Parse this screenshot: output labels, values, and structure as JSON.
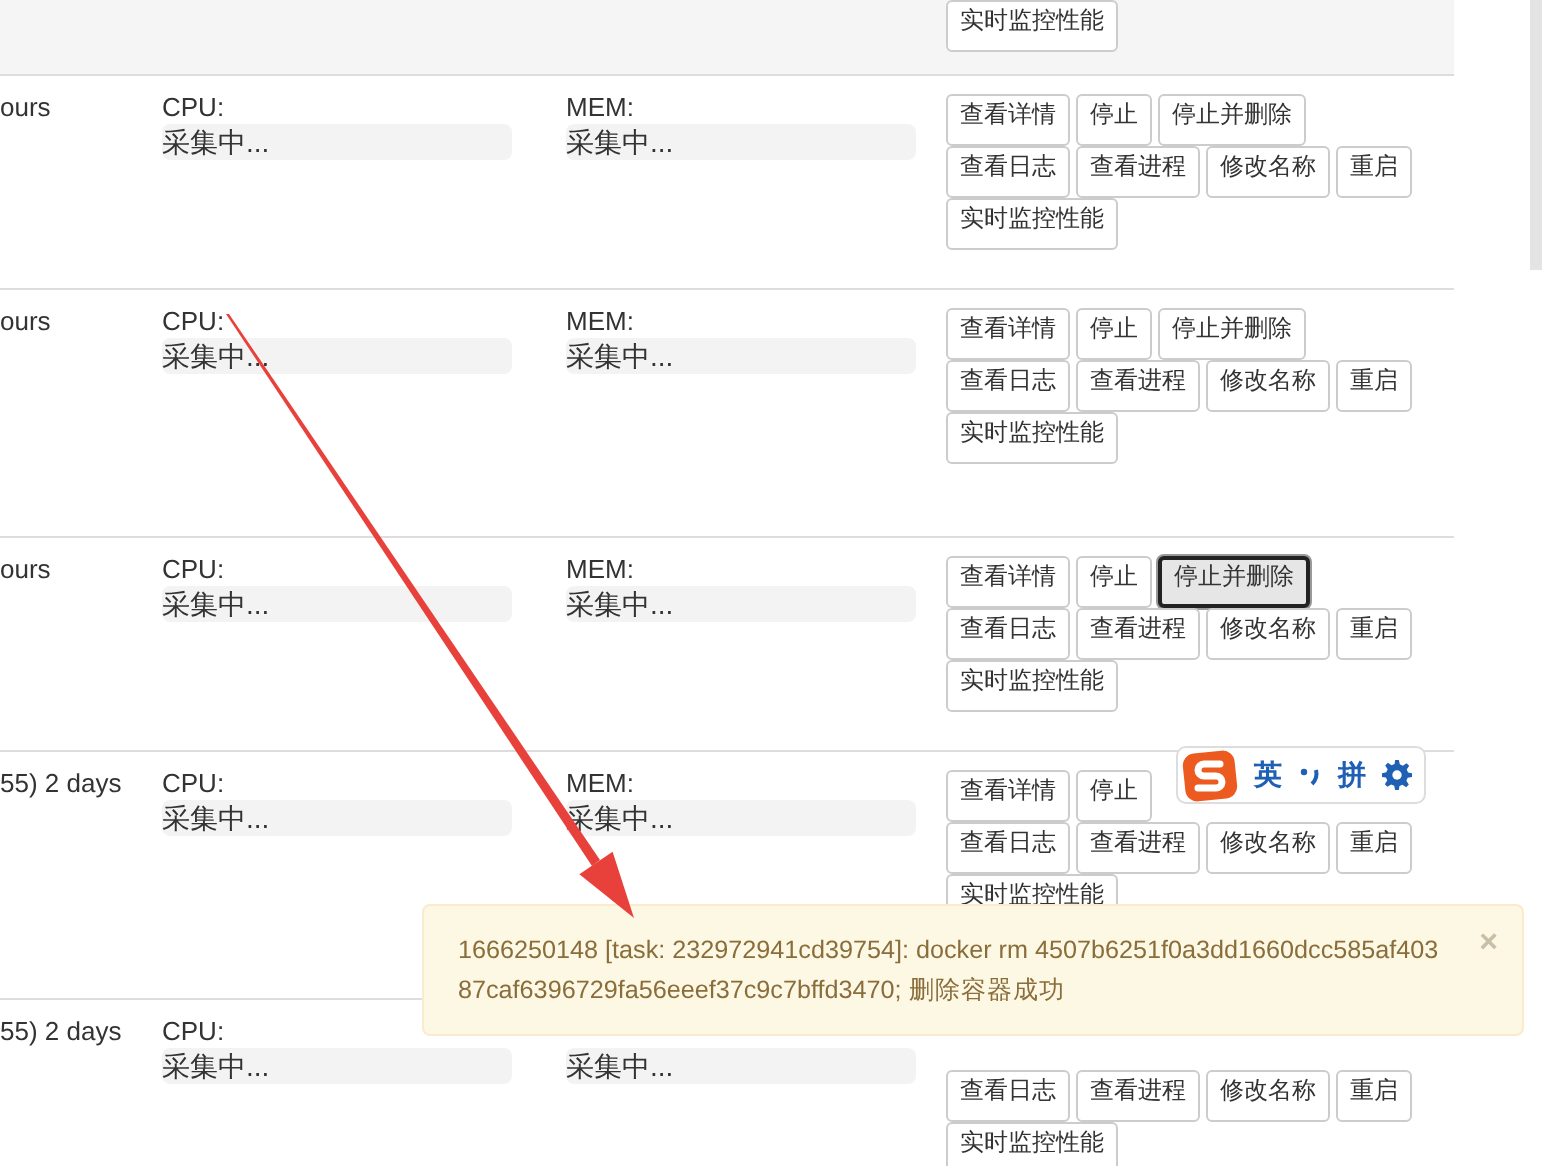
{
  "rows": [
    {
      "hovered": true,
      "buttons": [
        [
          {
            "label": "实时监控性能",
            "focused": false
          }
        ]
      ]
    },
    {
      "hovered": false,
      "uptime": "ours",
      "cpu": {
        "label": "CPU:",
        "reading": "采集中...",
        "level": 0
      },
      "mem": {
        "label": "MEM:",
        "reading": "采集中...",
        "level": 0
      },
      "buttons": [
        [
          {
            "label": "查看详情",
            "focused": false
          },
          {
            "label": "停止",
            "focused": false
          },
          {
            "label": "停止并删除",
            "focused": false
          }
        ],
        [
          {
            "label": "查看日志",
            "focused": false
          },
          {
            "label": "查看进程",
            "focused": false
          },
          {
            "label": "修改名称",
            "focused": false
          },
          {
            "label": "重启",
            "focused": false
          }
        ],
        [
          {
            "label": "实时监控性能",
            "focused": false
          }
        ]
      ]
    },
    {
      "hovered": false,
      "uptime": "ours",
      "cpu": {
        "label": "CPU:",
        "reading": "采集中...",
        "level": 0
      },
      "mem": {
        "label": "MEM:",
        "reading": "采集中...",
        "level": 0
      },
      "buttons": [
        [
          {
            "label": "查看详情",
            "focused": false
          },
          {
            "label": "停止",
            "focused": false
          },
          {
            "label": "停止并删除",
            "focused": false
          }
        ],
        [
          {
            "label": "查看日志",
            "focused": false
          },
          {
            "label": "查看进程",
            "focused": false
          },
          {
            "label": "修改名称",
            "focused": false
          },
          {
            "label": "重启",
            "focused": false
          }
        ],
        [
          {
            "label": "实时监控性能",
            "focused": false
          }
        ]
      ]
    },
    {
      "hovered": false,
      "uptime": "ours",
      "cpu": {
        "label": "CPU:",
        "reading": "采集中...",
        "level": 0
      },
      "mem": {
        "label": "MEM:",
        "reading": "采集中...",
        "level": 0
      },
      "buttons": [
        [
          {
            "label": "查看详情",
            "focused": false
          },
          {
            "label": "停止",
            "focused": false
          },
          {
            "label": "停止并删除",
            "focused": true
          }
        ],
        [
          {
            "label": "查看日志",
            "focused": false
          },
          {
            "label": "查看进程",
            "focused": false
          },
          {
            "label": "修改名称",
            "focused": false
          },
          {
            "label": "重启",
            "focused": false
          }
        ],
        [
          {
            "label": "实时监控性能",
            "focused": false
          }
        ]
      ]
    },
    {
      "hovered": false,
      "uptime": "55) 2 days",
      "cpu": {
        "label": "CPU:",
        "reading": "采集中...",
        "level": 0
      },
      "mem": {
        "label": "MEM:",
        "reading": "采集中...",
        "level": 0
      },
      "buttons": [
        [
          {
            "label": "查看详情",
            "focused": false
          },
          {
            "label": "停止",
            "focused": false
          }
        ],
        [
          {
            "label": "查看日志",
            "focused": false
          },
          {
            "label": "查看进程",
            "focused": false
          },
          {
            "label": "修改名称",
            "focused": false
          },
          {
            "label": "重启",
            "focused": false
          }
        ],
        [
          {
            "label": "实时监控性能",
            "focused": false
          }
        ]
      ]
    },
    {
      "hovered": false,
      "uptime": "55) 2 days",
      "cpu": {
        "label": "CPU:",
        "reading": "采集中...",
        "level": 0
      },
      "mem": {
        "reading": "采集中...",
        "level": 0
      },
      "buttons": [
        [
          {
            "label": "查看日志",
            "focused": false
          },
          {
            "label": "查看进程",
            "focused": false
          },
          {
            "label": "修改名称",
            "focused": false
          },
          {
            "label": "重启",
            "focused": false
          }
        ],
        [
          {
            "label": "实时监控性能",
            "focused": false
          }
        ]
      ]
    }
  ],
  "ime_toolbar": {
    "language": "英",
    "mode": "拼"
  },
  "toast": {
    "message": "1666250148 [task: 232972941cd39754]: docker rm 4507b6251f0a3dd1660dcc585af40387caf6396729fa56eeef37c9c7bffd3470; 删除容器成功",
    "close": "×"
  }
}
